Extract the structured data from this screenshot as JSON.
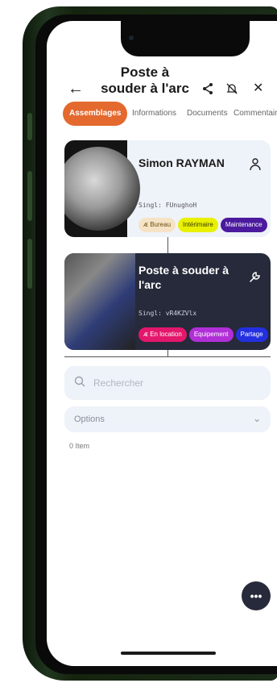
{
  "header": {
    "title": "Poste à souder à l'arc",
    "icons": [
      "arrow-left-icon",
      "share-icon",
      "bell-off-icon",
      "close-icon"
    ]
  },
  "tabs": [
    {
      "label": "Assemblages",
      "active": true
    },
    {
      "label": "Informations"
    },
    {
      "label": "Documents"
    },
    {
      "label": "Commentaires"
    }
  ],
  "person_card": {
    "name": "Simon RAYMAN",
    "singl": "Singl: FUnughoH",
    "icon": "person-icon",
    "tags": [
      {
        "label": "Bureau",
        "icon": "building-icon",
        "bg": "#f6e3c6",
        "color": "#6b4d10"
      },
      {
        "label": "Intérimaire",
        "bg": "#e9f000",
        "color": "#3a3a00"
      },
      {
        "label": "Maintenance",
        "bg": "#4b1a9e",
        "color": "#ffffff"
      }
    ]
  },
  "tool_card": {
    "name": "Poste à souder à l'arc",
    "singl": "Singl: vR4KZVlx",
    "icon": "wrench-icon",
    "tags": [
      {
        "label": "En location",
        "icon": "building-icon",
        "bg": "#e3176c",
        "color": "#ffffff"
      },
      {
        "label": "Equipement",
        "bg": "#b12fd6",
        "color": "#ffffff"
      },
      {
        "label": "Partage",
        "bg": "#2430e0",
        "color": "#ffffff"
      }
    ]
  },
  "search": {
    "placeholder": "Rechercher",
    "icon": "search-icon"
  },
  "options": {
    "label": "Options"
  },
  "item_count": "0 Item",
  "fab": {
    "icon": "more-horizontal-icon",
    "label": "•••"
  },
  "colors": {
    "accent": "#e3692f",
    "card_dark": "#262a3a",
    "card_light": "#eef2f9"
  }
}
